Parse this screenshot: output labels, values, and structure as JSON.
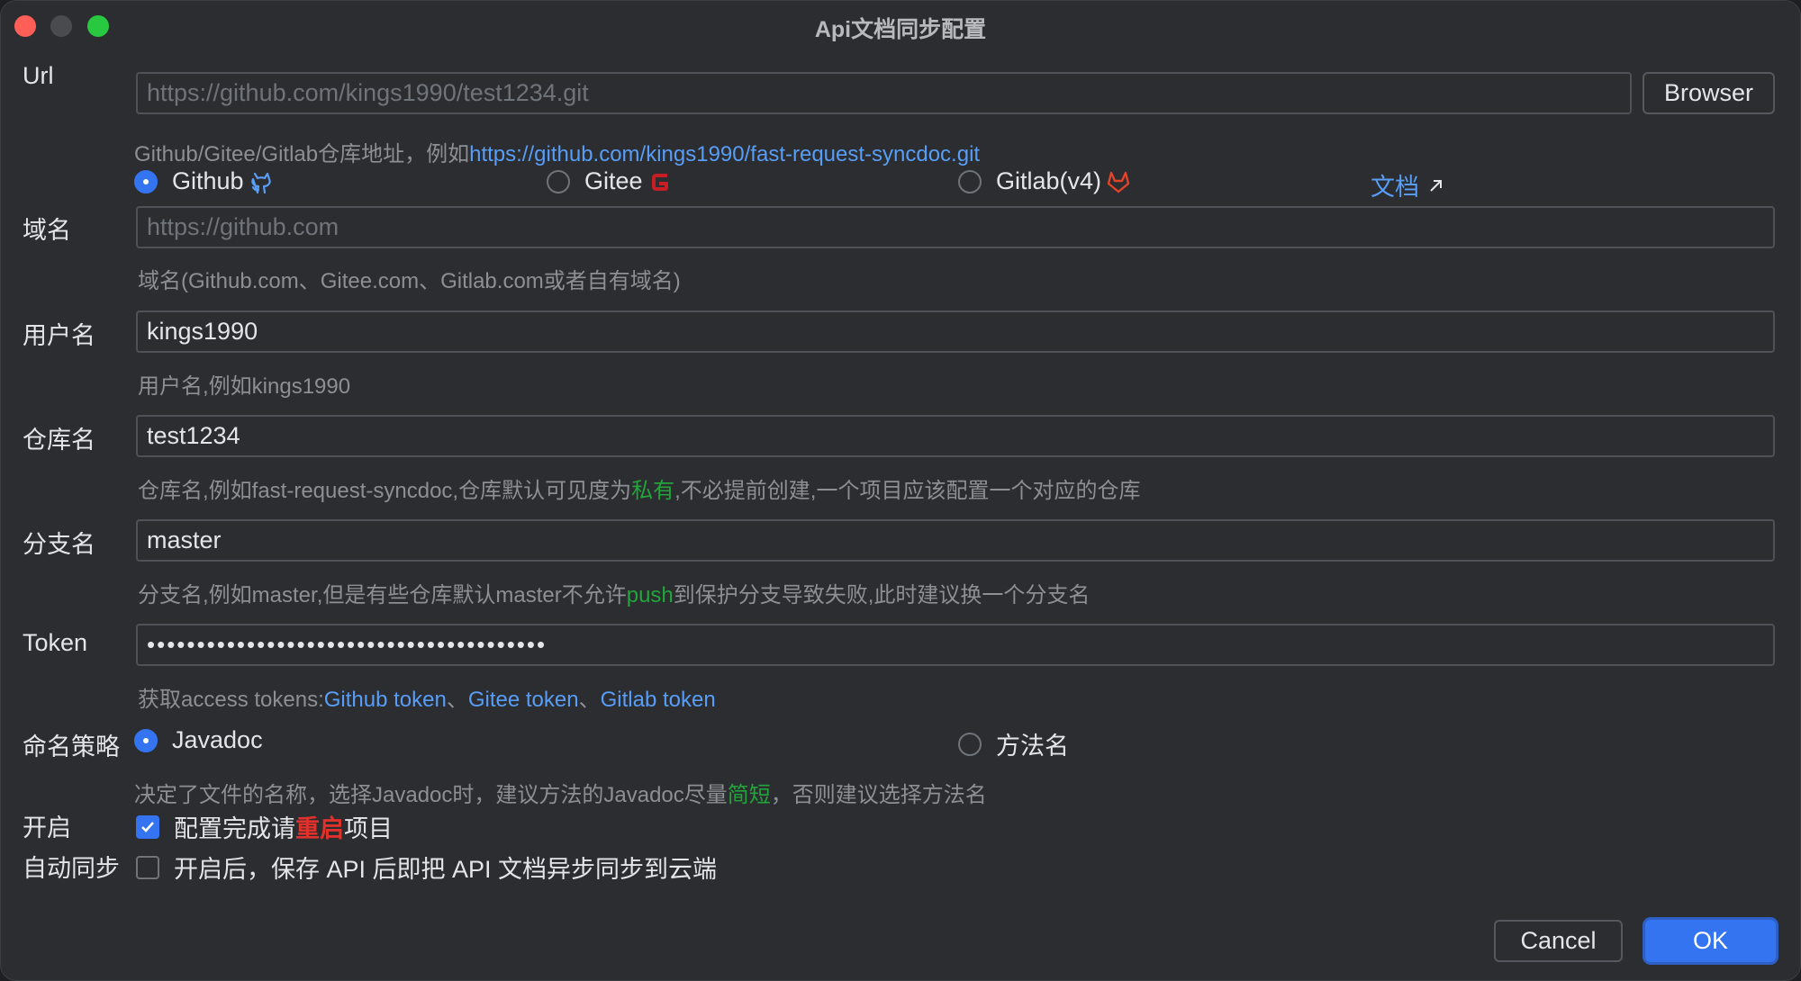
{
  "window": {
    "title": "Api文档同步配置"
  },
  "url": {
    "label": "Url",
    "placeholder": "https://github.com/kings1990/test1234.git",
    "browse_button": "Browser",
    "hint_prefix": "Github/Gitee/Gitlab仓库地址，例如",
    "hint_link": "https://github.com/kings1990/fast-request-syncdoc.git"
  },
  "providers": {
    "options": [
      {
        "label": "Github",
        "selected": true
      },
      {
        "label": "Gitee",
        "selected": false
      },
      {
        "label": "Gitlab(v4)",
        "selected": false
      }
    ],
    "doc_link": "文档"
  },
  "domain": {
    "label": "域名",
    "placeholder": "https://github.com",
    "hint": "域名(Github.com、Gitee.com、Gitlab.com或者自有域名)"
  },
  "username": {
    "label": "用户名",
    "value": "kings1990",
    "hint": "用户名,例如kings1990"
  },
  "repo": {
    "label": "仓库名",
    "value": "test1234",
    "hint_before": "仓库名,例如fast-request-syncdoc,仓库默认可见度为",
    "hint_highlight": "私有",
    "hint_after": ",不必提前创建,一个项目应该配置一个对应的仓库"
  },
  "branch": {
    "label": "分支名",
    "value": "master",
    "hint_before": "分支名,例如master,但是有些仓库默认master不允许",
    "hint_highlight": "push",
    "hint_after": "到保护分支导致失败,此时建议换一个分支名"
  },
  "token": {
    "label": "Token",
    "value": "••••••••••••••••••••••••••••••••••••••••",
    "hint_prefix": "获取access tokens:",
    "links": [
      "Github token",
      "Gitee token",
      "Gitlab token"
    ],
    "separator": "、"
  },
  "naming": {
    "label": "命名策略",
    "options": [
      {
        "label": "Javadoc",
        "selected": true
      },
      {
        "label": "方法名",
        "selected": false
      }
    ],
    "hint_before": "决定了文件的名称，选择Javadoc时，建议方法的Javadoc尽量",
    "hint_highlight": "简短",
    "hint_after": "，否则建议选择方法名"
  },
  "enable": {
    "label": "开启",
    "checked": true,
    "text_before": "配置完成请",
    "text_highlight": "重启",
    "text_after": "项目"
  },
  "autosync": {
    "label": "自动同步",
    "checked": false,
    "text": "开启后，保存 API 后即把 API 文档异步同步到云端"
  },
  "footer": {
    "cancel": "Cancel",
    "ok": "OK"
  },
  "colors": {
    "accent": "#3574f0",
    "link": "#589df6",
    "highlight_green": "#22a53a",
    "highlight_red": "#e0312b",
    "gitee_red": "#c71d23",
    "gitlab_orange": "#e24329"
  }
}
